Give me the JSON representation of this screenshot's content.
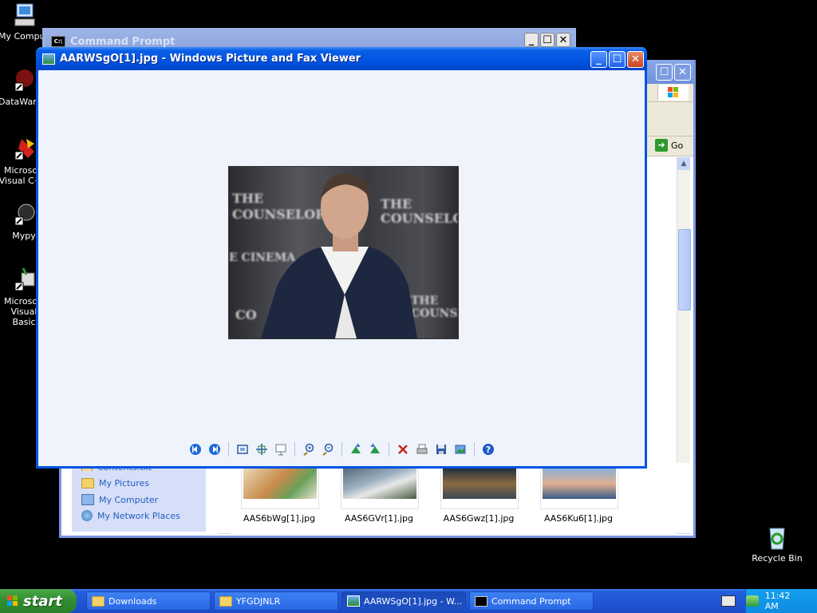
{
  "desktop": {
    "icons": [
      {
        "label": "My Computer"
      },
      {
        "label": "DataWarehouse"
      },
      {
        "label": "Microsoft Visual C++"
      },
      {
        "label": "Mypy"
      },
      {
        "label": "Microsoft Visual Basic"
      }
    ],
    "recycle_bin": "Recycle Bin"
  },
  "cmd_window": {
    "title": "Command Prompt"
  },
  "viewer": {
    "title": "AARWSgO[1].jpg - Windows Picture and Fax Viewer",
    "photo_texts": [
      "THE COUNSELOR",
      "THE COUNSELOR",
      "E CINEMA",
      "THE COUNSEL",
      "CO"
    ]
  },
  "explorer": {
    "go_label": "Go",
    "tasks": [
      {
        "label": "Contents.txt"
      },
      {
        "label": "My Pictures"
      },
      {
        "label": "My Computer"
      },
      {
        "label": "My Network Places"
      }
    ],
    "thumbnails": [
      {
        "label": "AAS6bWg[1].jpg"
      },
      {
        "label": "AAS6GVr[1].jpg"
      },
      {
        "label": "AAS6Gwz[1].jpg"
      },
      {
        "label": "AAS6Ku6[1].jpg"
      }
    ]
  },
  "taskbar": {
    "start_label": "start",
    "buttons": [
      {
        "label": "Downloads"
      },
      {
        "label": "YFGDJNLR"
      },
      {
        "label": "AARWSgO[1].jpg - W..."
      },
      {
        "label": "Command Prompt"
      }
    ],
    "clock": "11:42 AM"
  }
}
